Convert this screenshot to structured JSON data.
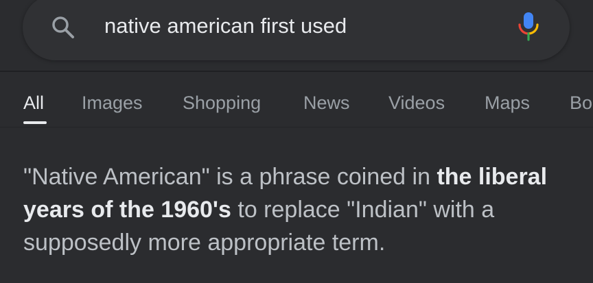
{
  "search": {
    "query": "native american first used",
    "icon": "search-icon",
    "mic_icon": "microphone-icon"
  },
  "tabs": [
    {
      "label": "All",
      "active": true
    },
    {
      "label": "Images",
      "active": false
    },
    {
      "label": "Shopping",
      "active": false
    },
    {
      "label": "News",
      "active": false
    },
    {
      "label": "Videos",
      "active": false
    },
    {
      "label": "Maps",
      "active": false
    },
    {
      "label": "Bo",
      "active": false
    }
  ],
  "snippet": {
    "part1": "\"Native American\" is a phrase coined in ",
    "bold": "the liberal years of the 1960's",
    "part2": " to replace \"Indian\" with a supposedly more appropriate term."
  },
  "colors": {
    "background": "#2b2c2f",
    "search_box": "#303134",
    "text_primary": "#e8eaed",
    "text_secondary": "#9aa0a6",
    "snippet_text": "#bdc1c6"
  }
}
